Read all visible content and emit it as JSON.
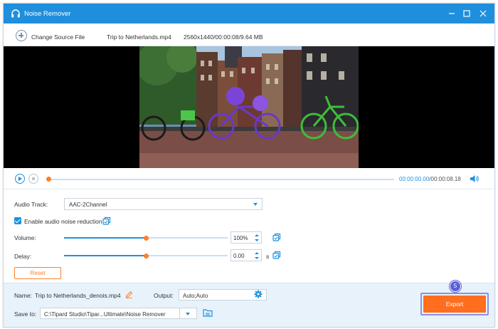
{
  "window": {
    "title": "Noise Remover"
  },
  "toolbar": {
    "change_source_label": "Change Source File",
    "file_name": "Trip to Netherlands.mp4",
    "file_info": "2560x1440/00:00:08/9.64 MB"
  },
  "player": {
    "current_time": "00:00:00.00",
    "separator": "/",
    "total_time": "00:00:08.18",
    "progress": 0
  },
  "settings": {
    "audio_track_label": "Audio Track:",
    "audio_track_value": "AAC-2Channel",
    "noise_reduction_label": "Enable audio noise reduction",
    "noise_reduction_checked": true,
    "volume_label": "Volume:",
    "volume_value": "100%",
    "volume_level": 0.5,
    "delay_label": "Delay:",
    "delay_value": "0.00",
    "delay_unit": "s",
    "delay_level": 0.5,
    "reset_label": "Reset"
  },
  "output": {
    "name_label": "Name:",
    "name_value": "Trip to Netherlands_denois.mp4",
    "output_label": "Output:",
    "output_value": "Auto;Auto",
    "save_to_label": "Save to:",
    "save_to_value": "C:\\Tipard Studio\\Tipar...Ultimate\\Noise Remover",
    "export_label": "Export",
    "step_badge": "5"
  },
  "colors": {
    "accent": "#1f8fdd",
    "slider_knob": "#ff7f2a",
    "export_button": "#ff6e1f",
    "badge": "#5b5fd9"
  },
  "icons": {
    "app": "headphones-icon",
    "add": "plus-circle-icon",
    "play": "play-icon",
    "stop": "stop-icon",
    "volume": "speaker-icon",
    "copy": "copy-icon",
    "edit": "pencil-icon",
    "settings": "gear-icon",
    "folder": "folder-icon"
  }
}
